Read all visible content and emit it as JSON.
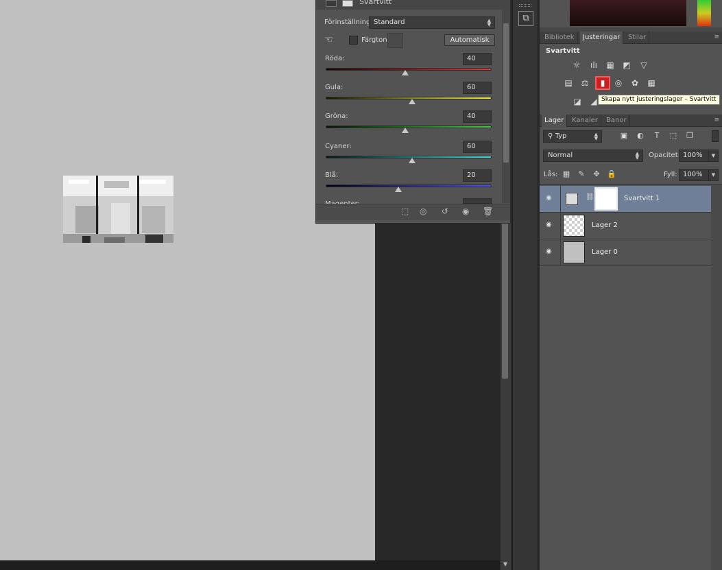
{
  "properties": {
    "title": "Svartvitt",
    "preset_label": "Förinställning:",
    "preset_value": "Standard",
    "tint_label": "Färgton",
    "auto_button": "Automatisk",
    "channels": [
      {
        "label": "Röda:",
        "value": "40",
        "gradient": [
          "#1a0000",
          "#e04040"
        ]
      },
      {
        "label": "Gula:",
        "value": "60",
        "gradient": [
          "#1a1a00",
          "#f0f040"
        ]
      },
      {
        "label": "Gröna:",
        "value": "40",
        "gradient": [
          "#001a00",
          "#40d040"
        ]
      },
      {
        "label": "Cyaner:",
        "value": "60",
        "gradient": [
          "#001a1a",
          "#40e0e0"
        ]
      },
      {
        "label": "Blå:",
        "value": "20",
        "gradient": [
          "#00001a",
          "#5050ff"
        ]
      },
      {
        "label": "Magenter:",
        "value": ""
      }
    ]
  },
  "adjustments": {
    "tabs": [
      "Bibliotek",
      "Justeringar",
      "Stilar"
    ],
    "active_tab": "Justeringar",
    "heading": "Svartvitt",
    "tooltip": "Skapa nytt justeringslager – Svartvitt"
  },
  "layers": {
    "tabs": [
      "Lager",
      "Kanaler",
      "Banor"
    ],
    "active_tab": "Lager",
    "filter_value": "Typ",
    "blend_mode": "Normal",
    "opacity_label": "Opacitet:",
    "opacity_value": "100%",
    "lock_label": "Lås:",
    "fill_label": "Fyll:",
    "fill_value": "100%",
    "items": [
      {
        "name": "Svartvitt 1",
        "selected": true
      },
      {
        "name": "Lager 2",
        "selected": false
      },
      {
        "name": "Lager 0",
        "selected": false
      }
    ]
  },
  "colors": {
    "canvas": "#c0c0c0",
    "panel": "#535353",
    "selected_layer": "#6e7f97",
    "accent_bw_icon": "#c72020"
  }
}
